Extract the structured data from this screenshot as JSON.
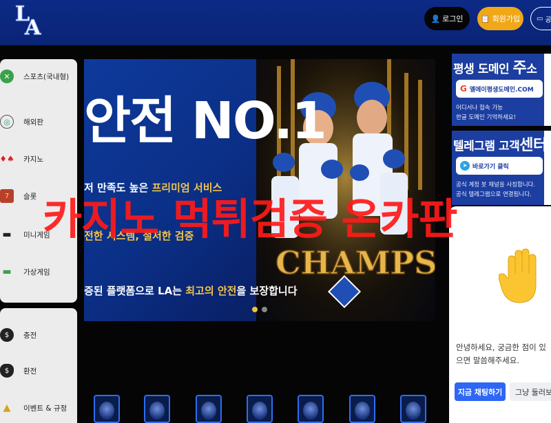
{
  "header": {
    "logo_alt": "LA",
    "login_label": "로그인",
    "signup_label": "회원가입",
    "extra_label": "공지"
  },
  "sidebar": {
    "menu_primary": [
      {
        "label": "스포츠(국내형)",
        "icon": "sports-icon"
      },
      {
        "label": "해외판",
        "icon": "globe-icon"
      },
      {
        "label": "카지노",
        "icon": "cards-icon"
      },
      {
        "label": "슬롯",
        "icon": "slot-machine-icon"
      },
      {
        "label": "미니게임",
        "icon": "gamepad-icon"
      },
      {
        "label": "가상게임",
        "icon": "virtual-game-icon"
      }
    ],
    "menu_secondary": [
      {
        "label": "충전",
        "icon": "coin-icon"
      },
      {
        "label": "환전",
        "icon": "money-bag-icon"
      },
      {
        "label": "이벤트 & 규정",
        "icon": "event-icon"
      }
    ]
  },
  "banner": {
    "headline": "안전 NO.1",
    "line1_prefix": "저 만족도 높은 ",
    "line1_highlight": "프리미엄 서비스",
    "line2_prefix": "전한 시스템, 철저한 검증",
    "line3_prefix": "증된 플랫폼으로 LA는 ",
    "line3_highlight": "최고의 안전",
    "line3_suffix": "을 보장합니다",
    "champs_text": "CHAMPS"
  },
  "promo1": {
    "title_a": "평생 도메인 ",
    "title_b": "주",
    "title_c": "소",
    "pill_text": "엘에이평생도메인.COM",
    "line1": "어디서나 접속 가능",
    "line2": "한글 도메인 기억하세요!"
  },
  "promo2": {
    "title_a": "텔레그램 고객",
    "title_b": "센터",
    "pill_text": "바로가기 클릭",
    "line1": "공식 계정 봇 채널을 사칭합니다.",
    "line2": "공식 텔레그램으로 연결됩니다."
  },
  "chat": {
    "message": "안녕하세요, 궁금한 점이 있으면 말씀해주세요.",
    "primary_button": "지금 채팅하기",
    "secondary_button": "그냥 둘러보기"
  },
  "watermark": "카지노 먹튀검증 온카판",
  "colors": {
    "header_bg": "#0c2a86",
    "signup": "#f0a818",
    "watermark": "#ff1a1a",
    "chat_primary": "#2e66f5"
  }
}
